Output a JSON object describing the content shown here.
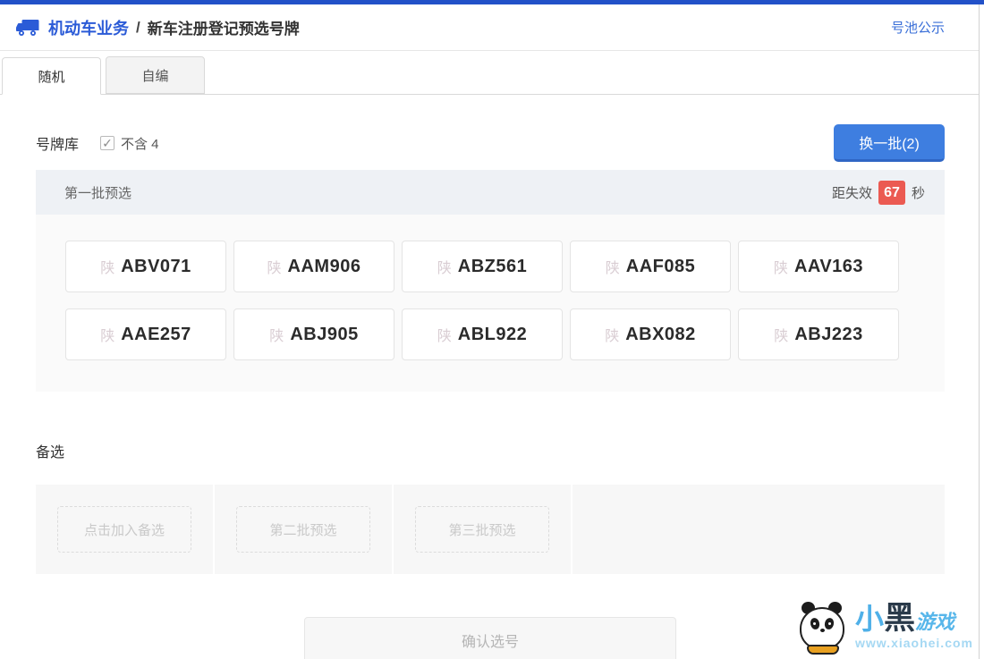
{
  "colors": {
    "topbar_blue": "#2251c8",
    "brand_blue": "#2b5bd7",
    "accent_blue": "#3e7ee0",
    "badge_red": "#eb5a52"
  },
  "header": {
    "brand": "机动车业务",
    "separator": "/",
    "page_title": "新车注册登记预选号牌",
    "pool_link": "号池公示"
  },
  "tabs": {
    "random": "随机",
    "custom": "自编",
    "active_tab": "随机"
  },
  "library": {
    "label": "号牌库",
    "exclude4_label": "不含 4",
    "exclude4_checked": true,
    "refresh_button": "换一批(2)"
  },
  "batch": {
    "title": "第一批预选",
    "expiry_prefix": "距失效",
    "expiry_seconds": "67",
    "expiry_suffix": "秒"
  },
  "plates": {
    "province": "陕",
    "row1": [
      "ABV071",
      "AAM906",
      "ABZ561",
      "AAF085",
      "AAV163"
    ],
    "row2": [
      "AAE257",
      "ABJ905",
      "ABL922",
      "ABX082",
      "ABJ223"
    ]
  },
  "alternatives": {
    "title": "备选",
    "slot1": "点击加入备选",
    "slot2": "第二批预选",
    "slot3": "第三批预选"
  },
  "confirm": {
    "label": "确认选号"
  },
  "icons": {
    "check": "✓"
  },
  "watermark": {
    "name_part1": "小",
    "name_part2": "黑",
    "name_part3": "游戏",
    "url": "www.xiaohei.com"
  }
}
